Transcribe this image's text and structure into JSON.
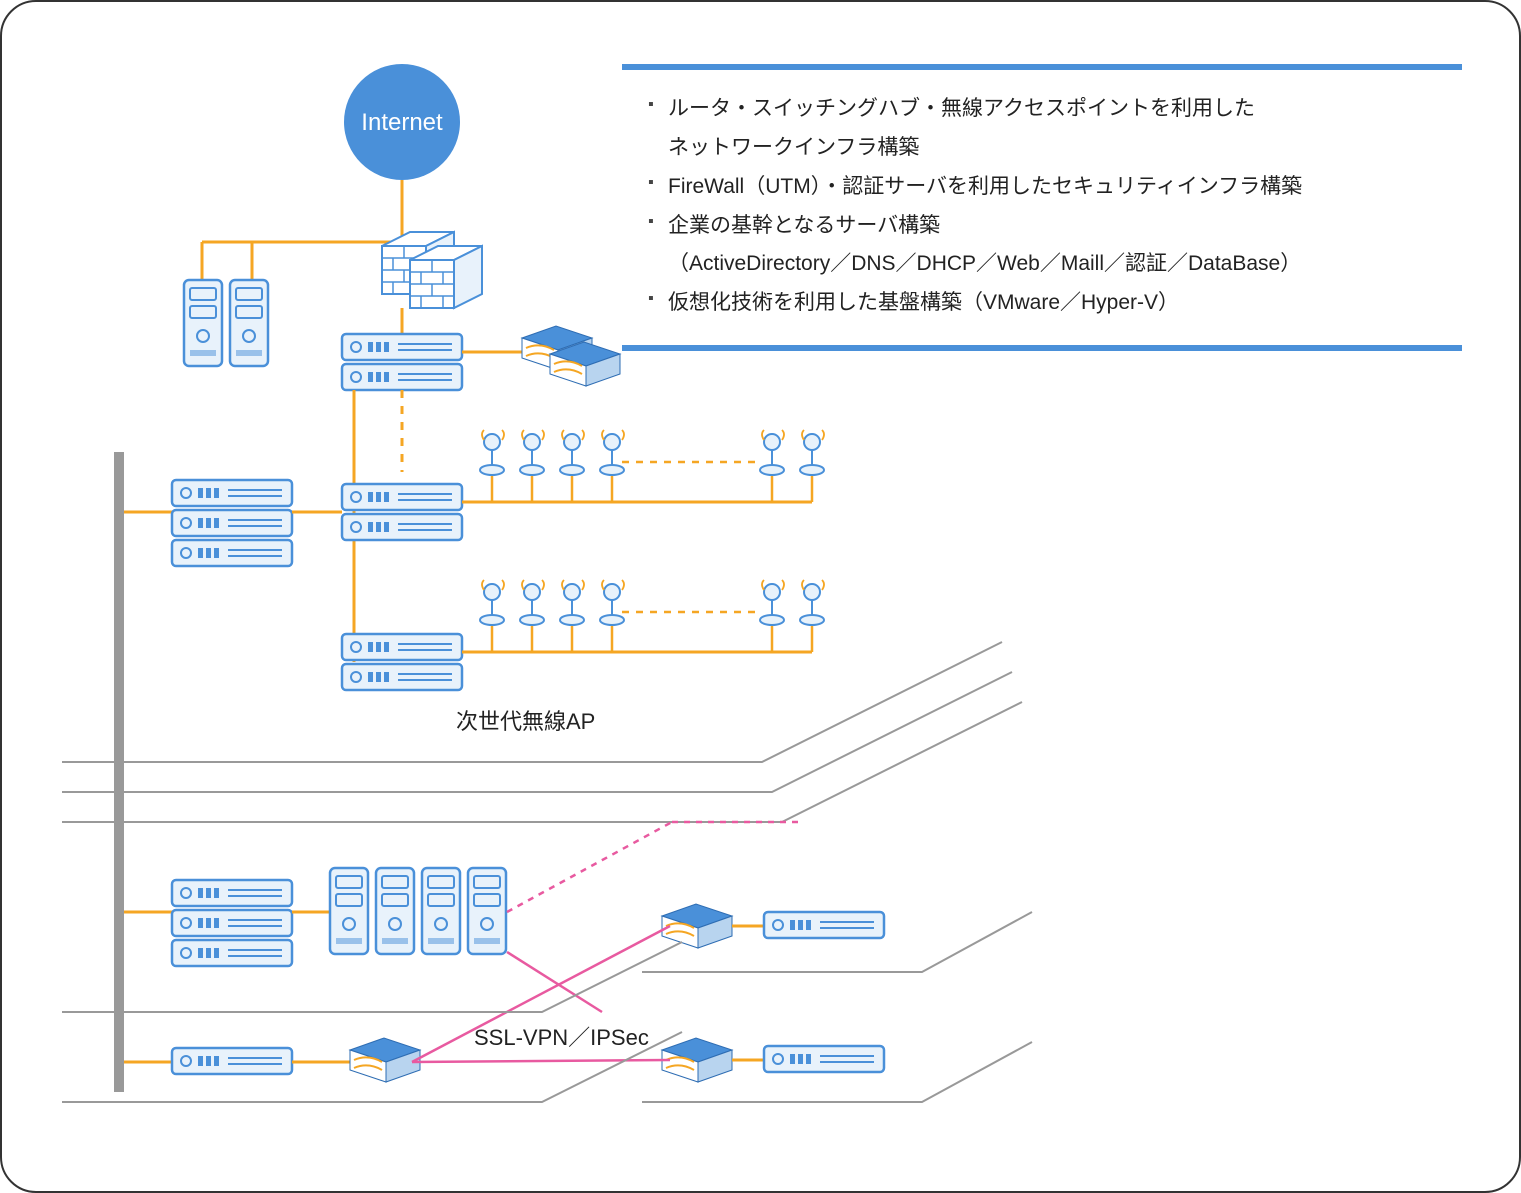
{
  "internet_label": "Internet",
  "wireless_ap_label": "次世代無線AP",
  "vpn_label": "SSL-VPN／IPSec",
  "info": {
    "line1": "ルータ・スイッチングハブ・無線アクセスポイントを利用した",
    "line1b": "ネットワークインフラ構築",
    "line2": "FireWall（UTM）・認証サーバを利用したセキュリティインフラ構築",
    "line3": "企業の基幹となるサーバ構築",
    "line3b": "（ActiveDirectory／DNS／DHCP／Web／Maill／認証／DataBase）",
    "line4": "仮想化技術を利用した基盤構築（VMware／Hyper-V）"
  },
  "colors": {
    "blue": "#4a90d9",
    "blue_fill": "#e8f2fb",
    "orange": "#f5a623",
    "gray": "#999999",
    "pink": "#e85aa0",
    "dark": "#333333"
  }
}
